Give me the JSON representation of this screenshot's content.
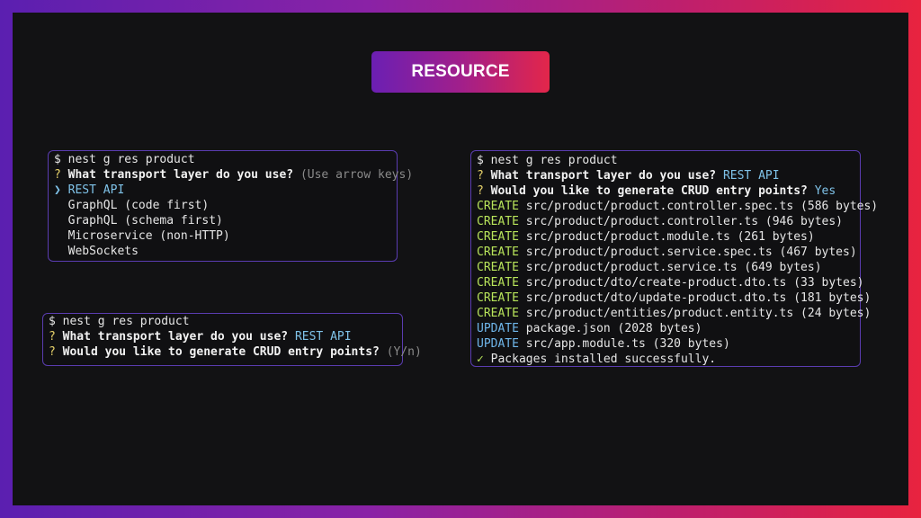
{
  "badge": {
    "label": "RESOURCE"
  },
  "terminal_left_top": {
    "command": "$ nest g res product",
    "question_prefix": "?",
    "question": "What transport layer do you use?",
    "hint": "(Use arrow keys)",
    "pointer": "❯",
    "options": [
      "REST API",
      "GraphQL (code first)",
      "GraphQL (schema first)",
      "Microservice (non-HTTP)",
      "WebSockets"
    ]
  },
  "terminal_left_bottom": {
    "command": "$ nest g res product",
    "q1_prefix": "?",
    "q1": "What transport layer do you use?",
    "q1_answer": "REST API",
    "q2_prefix": "?",
    "q2": "Would you like to generate CRUD entry points?",
    "q2_hint": "(Y/n)"
  },
  "terminal_right": {
    "command": "$ nest g res product",
    "q1_prefix": "?",
    "q1": "What transport layer do you use?",
    "q1_answer": "REST API",
    "q2_prefix": "?",
    "q2": "Would you like to generate CRUD entry points?",
    "q2_answer": "Yes",
    "files": [
      {
        "action": "CREATE",
        "path": "src/product/product.controller.spec.ts (586 bytes)"
      },
      {
        "action": "CREATE",
        "path": "src/product/product.controller.ts (946 bytes)"
      },
      {
        "action": "CREATE",
        "path": "src/product/product.module.ts (261 bytes)"
      },
      {
        "action": "CREATE",
        "path": "src/product/product.service.spec.ts (467 bytes)"
      },
      {
        "action": "CREATE",
        "path": "src/product/product.service.ts (649 bytes)"
      },
      {
        "action": "CREATE",
        "path": "src/product/dto/create-product.dto.ts (33 bytes)"
      },
      {
        "action": "CREATE",
        "path": "src/product/dto/update-product.dto.ts (181 bytes)"
      },
      {
        "action": "CREATE",
        "path": "src/product/entities/product.entity.ts (24 bytes)"
      },
      {
        "action": "UPDATE",
        "path": "package.json (2028 bytes)"
      },
      {
        "action": "UPDATE",
        "path": "src/app.module.ts (320 bytes)"
      }
    ],
    "check_icon": "✓",
    "success": "Packages installed successfully."
  }
}
